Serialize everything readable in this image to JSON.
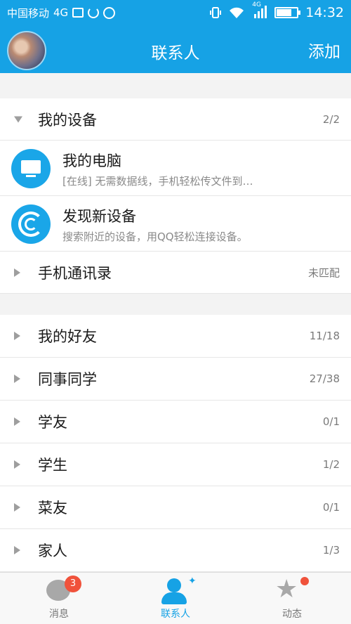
{
  "status_bar": {
    "carrier": "中国移动",
    "network": "4G",
    "signal_network": "4G",
    "time": "14:32",
    "battery_level": 0.7
  },
  "app_bar": {
    "title": "联系人",
    "add_label": "添加"
  },
  "devices": {
    "label": "我的设备",
    "count": "2/2",
    "items": [
      {
        "title": "我的电脑",
        "subtitle": "[在线] 无需数据线，手机轻松传文件到…",
        "icon": "monitor-icon"
      },
      {
        "title": "发现新设备",
        "subtitle": "搜索附近的设备，用QQ轻松连接设备。",
        "icon": "radar-icon"
      }
    ]
  },
  "phone_contacts": {
    "label": "手机通讯录",
    "status": "未匹配"
  },
  "groups": [
    {
      "label": "我的好友",
      "count": "11/18"
    },
    {
      "label": "同事同学",
      "count": "27/38"
    },
    {
      "label": "学友",
      "count": "0/1"
    },
    {
      "label": "学生",
      "count": "1/2"
    },
    {
      "label": "菜友",
      "count": "0/1"
    },
    {
      "label": "家人",
      "count": "1/3"
    }
  ],
  "bottom_nav": {
    "messages": {
      "label": "消息",
      "badge": "3"
    },
    "contacts": {
      "label": "联系人"
    },
    "feed": {
      "label": "动态"
    }
  },
  "colors": {
    "accent": "#16a2e5",
    "badge": "#f0523b"
  }
}
